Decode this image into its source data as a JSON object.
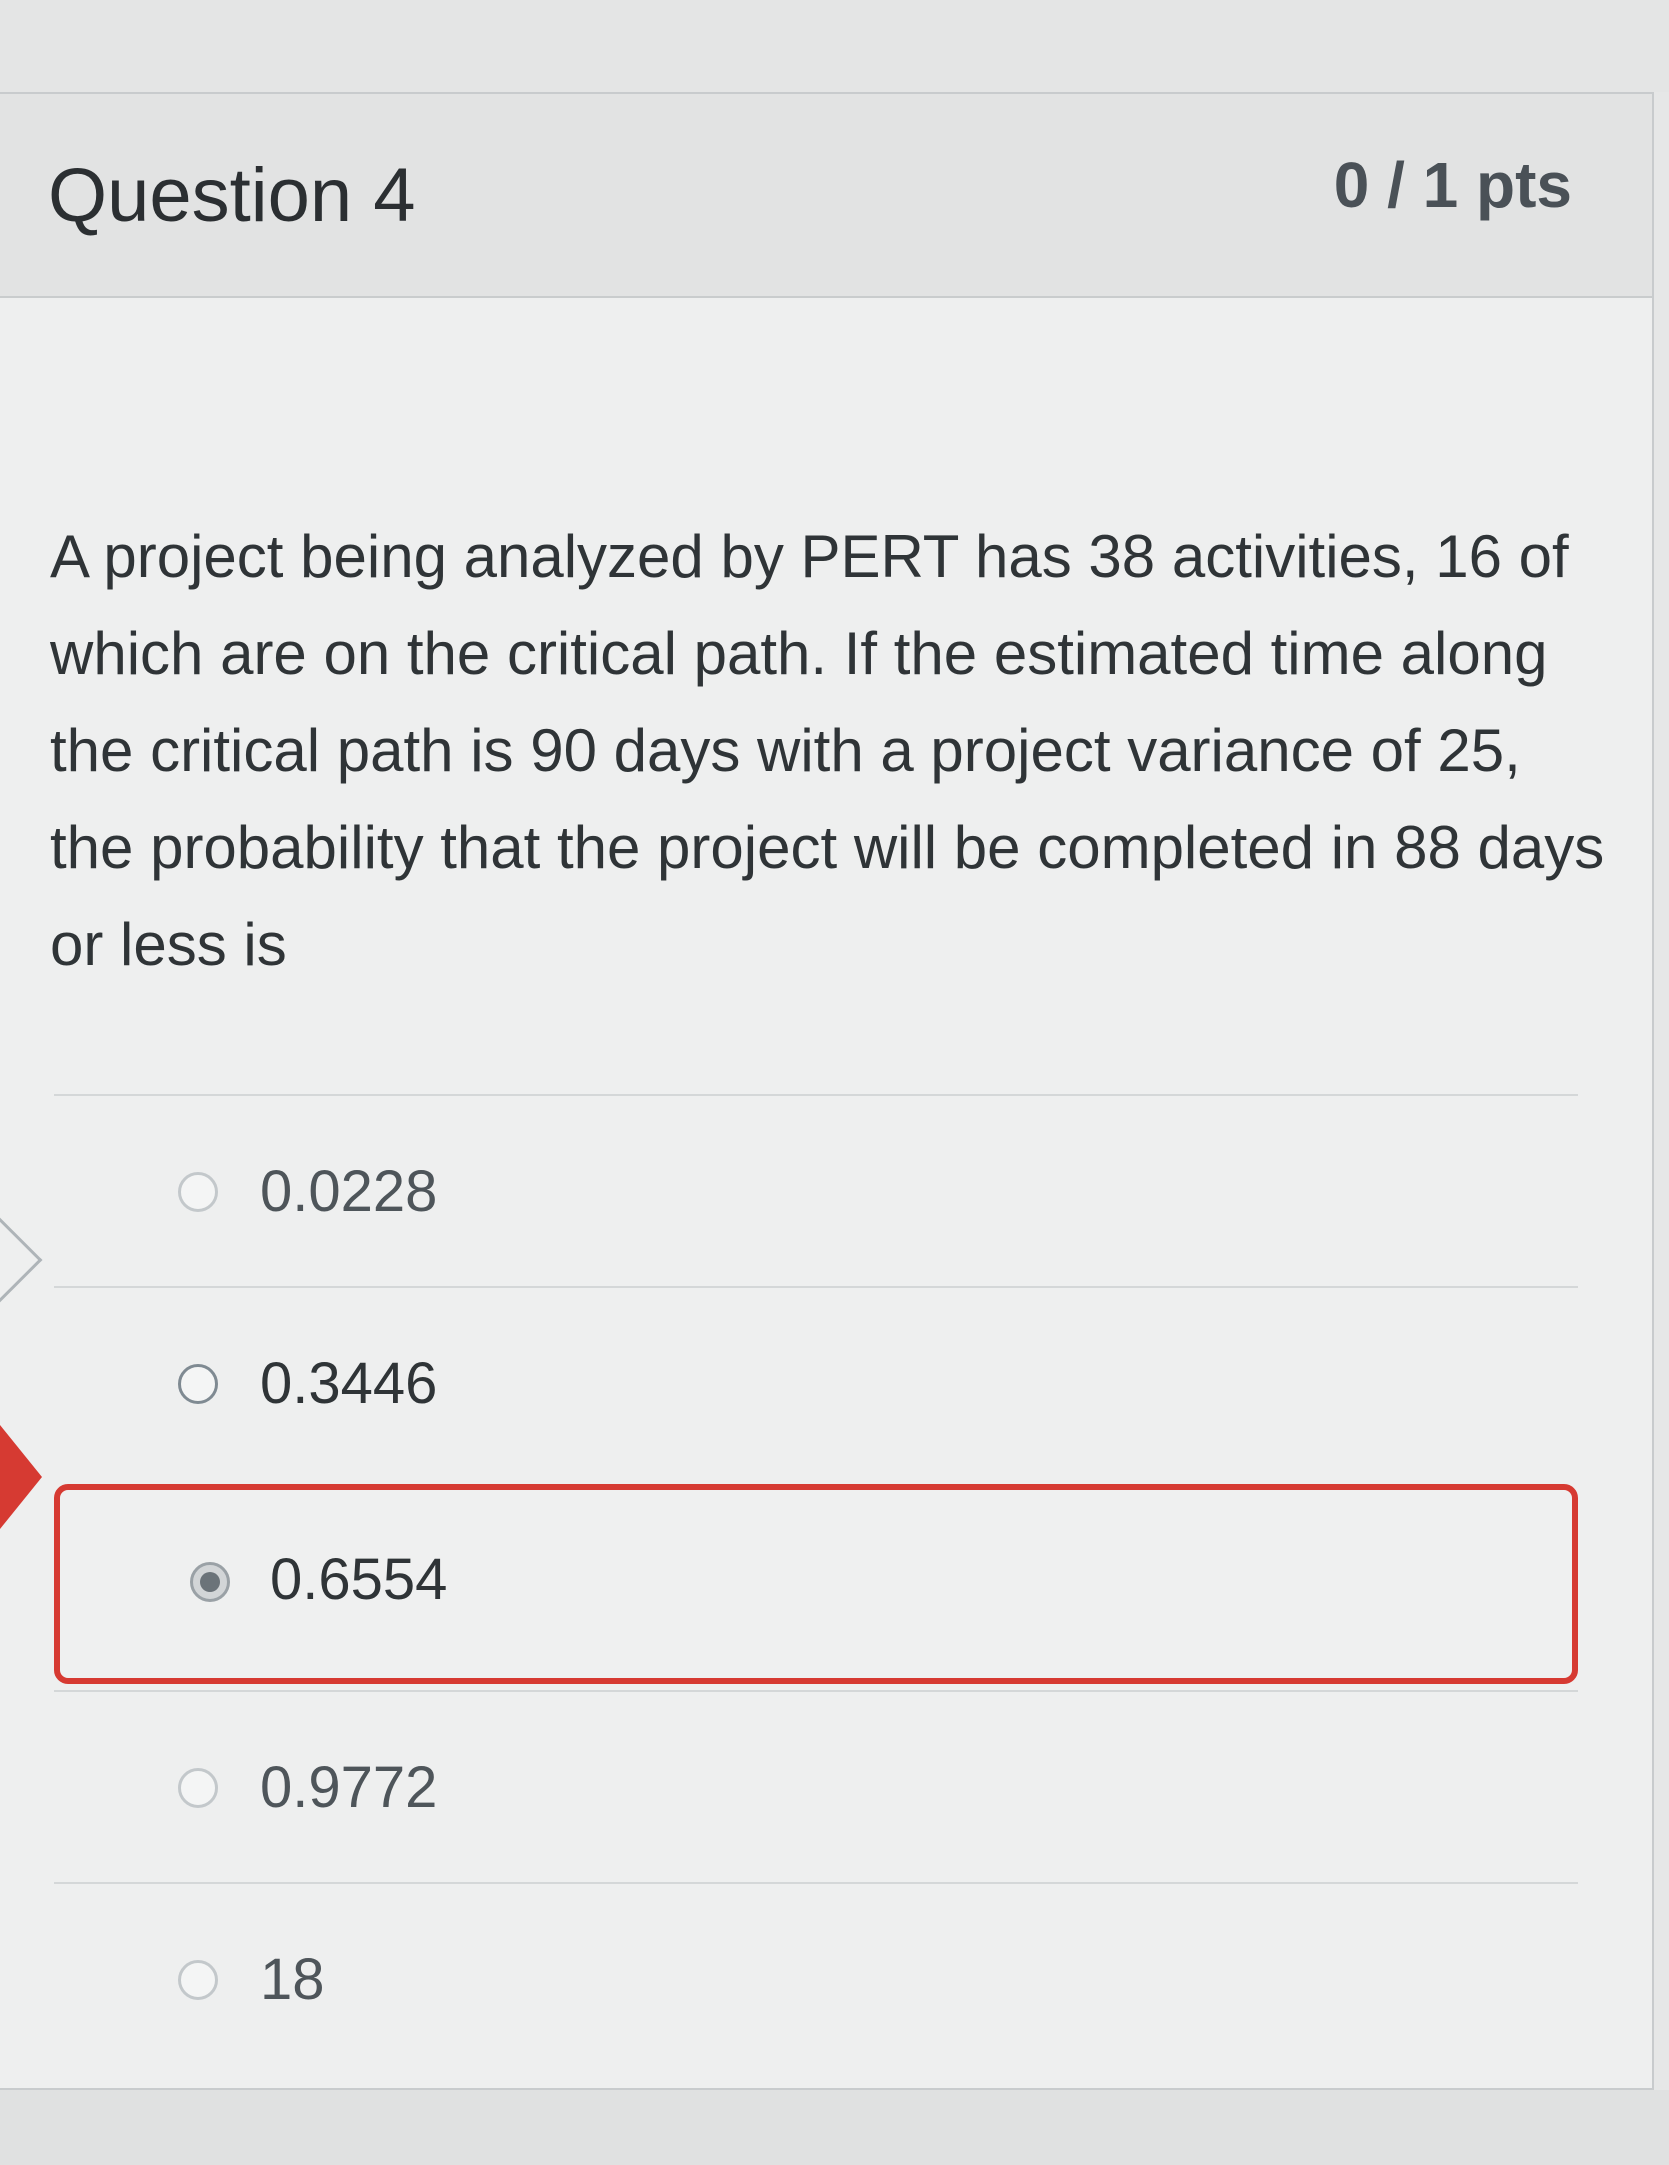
{
  "question": {
    "title": "Question 4",
    "points": "0 / 1 pts",
    "text": "A project being analyzed by PERT has 38 activities, 16 of which are on the critical path. If the estimated time along the critical path is 90 days with a project variance of 25, the probability that the project will be completed in 88 days or less is"
  },
  "answers": [
    {
      "label": "0.0228",
      "selected": false
    },
    {
      "label": "0.3446",
      "selected": false
    },
    {
      "label": "0.6554",
      "selected": true
    },
    {
      "label": "0.9772",
      "selected": false
    },
    {
      "label": "18",
      "selected": false
    }
  ],
  "colors": {
    "incorrect": "#d63a32",
    "text": "#2f3437",
    "card_bg": "#eeefef",
    "header_bg": "#e2e3e3"
  },
  "icons": {
    "incorrect_marker": "incorrect-answer-arrow-icon",
    "nav": "chevron-right-icon",
    "radio": "radio-button-icon"
  }
}
